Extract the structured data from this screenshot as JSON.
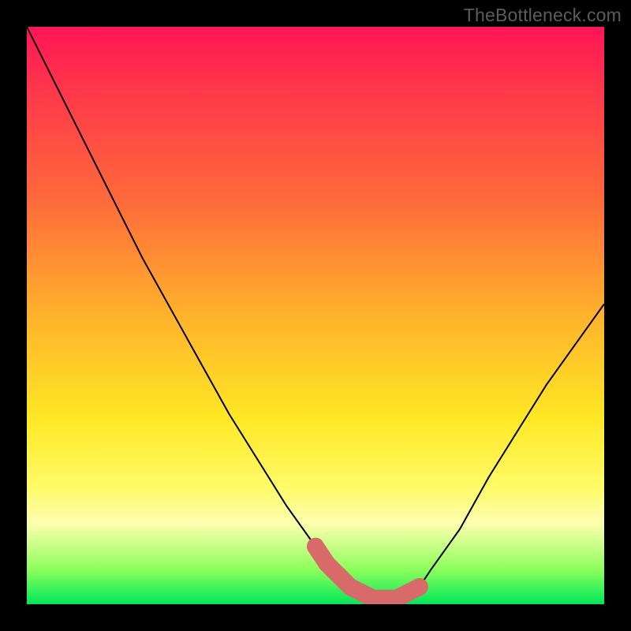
{
  "attribution": "TheBottleneck.com",
  "chart_data": {
    "type": "line",
    "title": "",
    "xlabel": "",
    "ylabel": "",
    "xlim": [
      0,
      100
    ],
    "ylim": [
      0,
      100
    ],
    "series": [
      {
        "name": "curve",
        "color": "#000000",
        "x": [
          0,
          5,
          10,
          15,
          20,
          25,
          30,
          35,
          40,
          45,
          50,
          52,
          54,
          56,
          58,
          60,
          62,
          64,
          66,
          68,
          70,
          75,
          80,
          85,
          90,
          95,
          100
        ],
        "values": [
          100,
          90,
          80,
          70,
          60,
          51,
          42,
          33,
          25,
          17,
          10,
          7,
          5,
          3,
          2,
          1,
          1,
          1,
          2,
          3,
          6,
          13,
          22,
          30,
          38,
          45,
          52
        ]
      }
    ],
    "marker_region": {
      "name": "trough-markers",
      "color": "#d86a6a",
      "x": [
        50,
        52,
        54,
        56,
        58,
        60,
        62,
        64,
        66,
        68
      ],
      "values": [
        10,
        7,
        5,
        3,
        2,
        1,
        1,
        1,
        2,
        3
      ]
    }
  },
  "palette": {
    "curve_stroke": "#000000",
    "marker_fill": "#d86a6a"
  }
}
